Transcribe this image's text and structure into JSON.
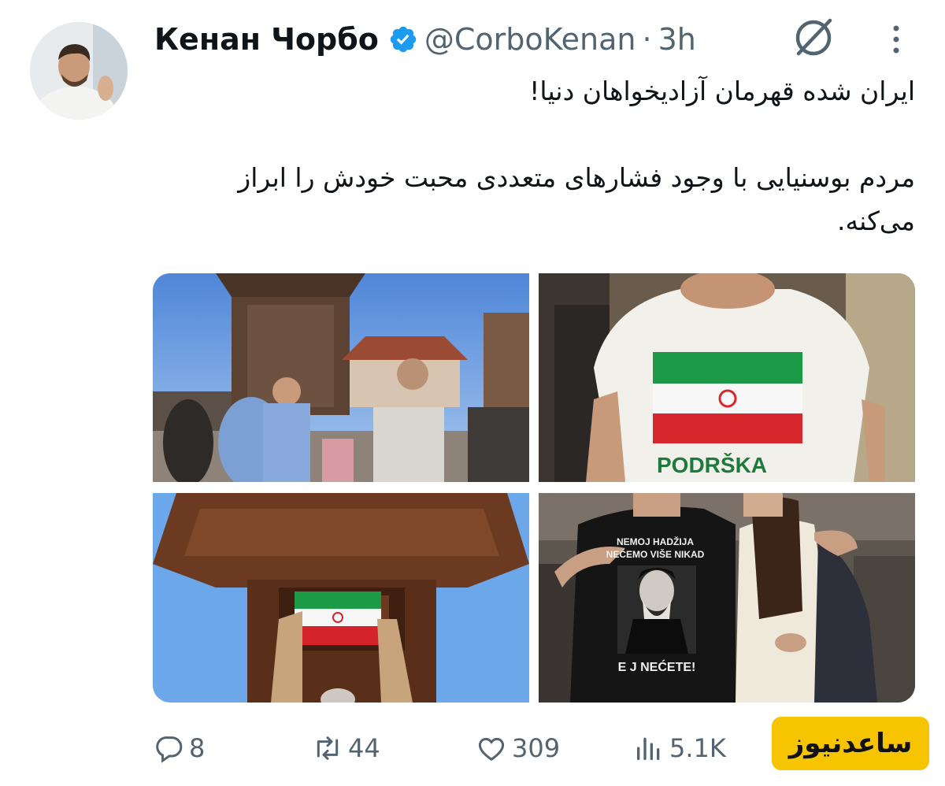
{
  "author": {
    "display_name": "Кенан Чорбо",
    "handle": "@CorboKenan",
    "separator": "·",
    "time": "3h",
    "verified_icon": "verified-badge-icon"
  },
  "tweet": {
    "line1": "ایران شده قهرمان آزادیخواهان دنیا!",
    "line2": "مردم بوسنیایی با وجود فشارهای متعددی محبت خودش را ابراز می‌کنه."
  },
  "photos": {
    "p2_shirt_text": "PODRŠKA",
    "p4_shirt_line1": "NEMOJ HADŽIJA",
    "p4_shirt_line2": "NEĆEMO VIŠE NIKAD",
    "p4_shirt_line3": "E J NEĆETE!"
  },
  "actions": {
    "replies": "8",
    "retweets": "44",
    "likes": "309",
    "views": "5.1K"
  },
  "watermark": "ساعدنیوز",
  "colors": {
    "verified": "#1d9bf0",
    "muted": "#536471",
    "watermark_bg": "#f6c400"
  }
}
